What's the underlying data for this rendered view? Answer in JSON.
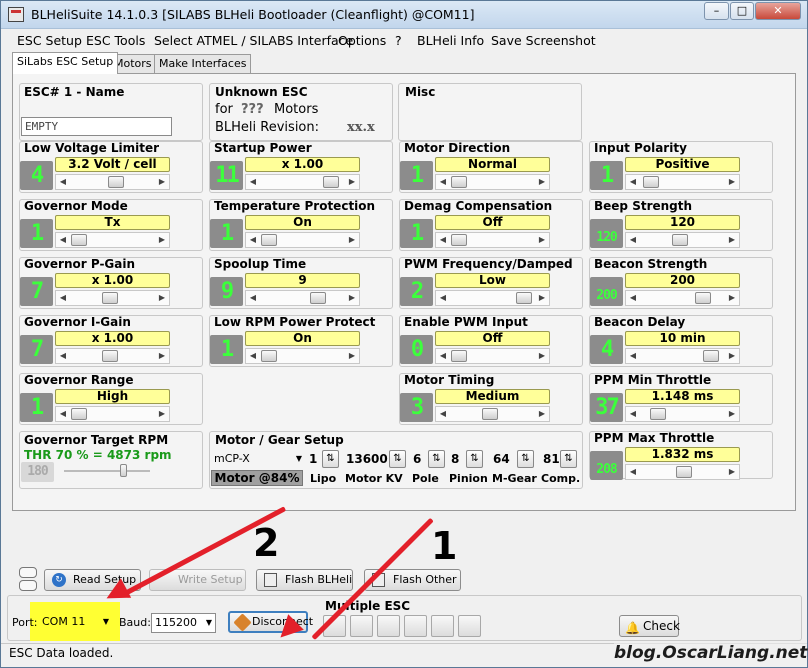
{
  "window": {
    "title": "BLHeliSuite 14.1.0.3  [SILABS BLHeli Bootloader (Cleanflight) @COM11]",
    "minimize_icon": "minimize-icon",
    "maximize_icon": "maximize-icon",
    "close_icon": "close-icon"
  },
  "menu": [
    "ESC Setup",
    "ESC Tools",
    "Select ATMEL / SILABS Interface",
    "Options",
    "?",
    "BLHeli Info",
    "Save Screenshot"
  ],
  "tabs": [
    "SiLabs ESC Setup",
    "Motors",
    "Make Interfaces"
  ],
  "esc_name": {
    "label": "ESC# 1 - Name",
    "value": "EMPTY"
  },
  "unknown_esc": {
    "line1": "Unknown ESC",
    "for": "for",
    "motors_count": "???",
    "motors": "Motors",
    "revision_label": "BLHeli Revision:",
    "revision_value": "xx.x"
  },
  "misc": {
    "label": "Misc"
  },
  "params": {
    "low_voltage": {
      "label": "Low Voltage Limiter",
      "value": "3.2 Volt / cell",
      "num": "4",
      "level": 0.55
    },
    "startup_power": {
      "label": "Startup Power",
      "value": "x 1.00",
      "num": "11",
      "level": 0.92
    },
    "motor_direction": {
      "label": "Motor Direction",
      "value": "Normal",
      "num": "1",
      "level": 0.02
    },
    "input_polarity": {
      "label": "Input Polarity",
      "value": "Positive",
      "num": "1",
      "level": 0.05
    },
    "governor_mode": {
      "label": "Governor Mode",
      "value": "Tx",
      "num": "1",
      "level": 0.02
    },
    "temp_protection": {
      "label": "Temperature Protection",
      "value": "On",
      "num": "1",
      "level": 0.02
    },
    "demag": {
      "label": "Demag Compensation",
      "value": "Off",
      "num": "1",
      "level": 0.02
    },
    "beep_strength": {
      "label": "Beep Strength",
      "value": "120",
      "num": "120",
      "level": 0.47
    },
    "gov_p_gain": {
      "label": "Governor P-Gain",
      "value": "x 1.00",
      "num": "7",
      "level": 0.47
    },
    "spoolup": {
      "label": "Spoolup Time",
      "value": "9",
      "num": "9",
      "level": 0.72
    },
    "pwm_freq": {
      "label": "PWM Frequency/Damped",
      "value": "Low",
      "num": "2",
      "level": 0.95
    },
    "beacon_strength": {
      "label": "Beacon Strength",
      "value": "200",
      "num": "200",
      "level": 0.79
    },
    "gov_i_gain": {
      "label": "Governor I-Gain",
      "value": "x 1.00",
      "num": "7",
      "level": 0.47
    },
    "low_rpm": {
      "label": "Low RPM Power Protect",
      "value": "On",
      "num": "1",
      "level": 0.02
    },
    "enable_pwm": {
      "label": "Enable PWM Input",
      "value": "Off",
      "num": "0",
      "level": 0.02
    },
    "beacon_delay": {
      "label": "Beacon Delay",
      "value": "10 min",
      "num": "4",
      "level": 0.92
    },
    "gov_range": {
      "label": "Governor Range",
      "value": "High",
      "num": "1",
      "level": 0.02
    },
    "motor_timing": {
      "label": "Motor Timing",
      "value": "Medium",
      "num": "3",
      "level": 0.47
    },
    "ppm_min": {
      "label": "PPM Min Throttle",
      "value": "1.148 ms",
      "num": "37",
      "level": 0.15
    },
    "ppm_max": {
      "label": "PPM Max Throttle",
      "value": "1.832 ms",
      "num": "208",
      "level": 0.52
    }
  },
  "gov_target": {
    "label": "Governor Target RPM",
    "thr": "THR 70 % = 4873 rpm",
    "num": "180",
    "level": 0.7
  },
  "motor_gear": {
    "label": "Motor / Gear Setup",
    "model": "mCP-X",
    "motor_pct": "Motor @84%",
    "lipo": "1",
    "lipo_label": "Lipo",
    "kv": "13600",
    "kv_label": "Motor KV",
    "pole": "6",
    "pole_label": "Pole",
    "pinion": "8",
    "pinion_label": "Pinion",
    "mgear": "64",
    "mgear_label": "M-Gear",
    "comp": "81",
    "comp_label": "Comp."
  },
  "buttons": {
    "read_setup": "Read Setup",
    "write_setup": "Write Setup",
    "flash_blheli": "Flash BLHeli",
    "flash_other": "Flash Other",
    "disconnect": "Disconnect",
    "check": "Check"
  },
  "port": {
    "label": "Port:",
    "value": "COM 11",
    "baud_label": "Baud:",
    "baud_value": "115200"
  },
  "multiple_esc": {
    "label": "Multiple ESC"
  },
  "status": "ESC Data loaded.",
  "annotations": {
    "step1": "1",
    "step2": "2"
  },
  "watermark": "blog.OscarLiang.net",
  "colors": {
    "value_bg": "#ffff99",
    "num_text": "#3cff3c",
    "num_bg": "#8c8c8c",
    "arrow": "#e3202a",
    "highlight": "#ffff33"
  }
}
